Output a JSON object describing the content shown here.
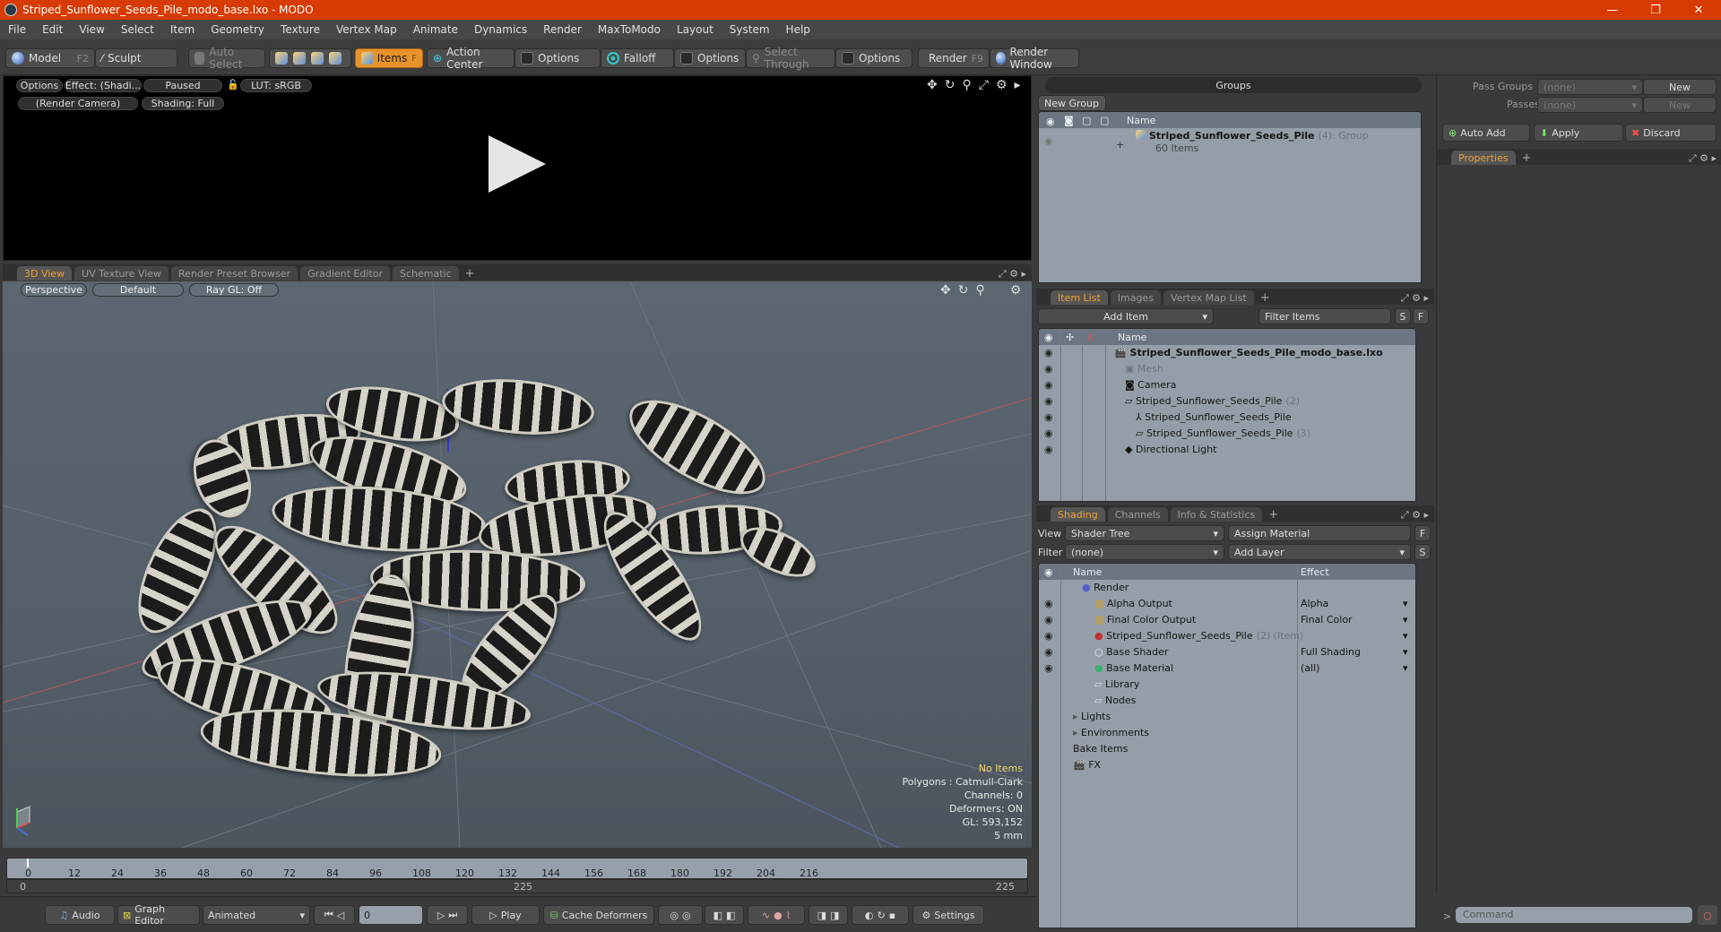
{
  "window": {
    "title": "Striped_Sunflower_Seeds_Pile_modo_base.lxo - MODO",
    "minimize": "—",
    "restore": "❐",
    "close": "✕"
  },
  "menu": [
    "File",
    "Edit",
    "View",
    "Select",
    "Item",
    "Geometry",
    "Texture",
    "Vertex Map",
    "Animate",
    "Dynamics",
    "Render",
    "MaxToModo",
    "Layout",
    "System",
    "Help"
  ],
  "toolbar": {
    "model": "Model",
    "model_key": "F2",
    "sculpt": "Sculpt",
    "auto_select": "Auto Select",
    "items": "Items",
    "items_key": "F",
    "action_center": "Action Center",
    "options1": "Options",
    "falloff": "Falloff",
    "options2": "Options",
    "select_through": "Select Through",
    "options3": "Options",
    "render": "Render",
    "render_key": "F9",
    "render_window": "Render Window"
  },
  "render_panel": {
    "options": "Options",
    "effect": "Effect: (Shadi...",
    "paused": "Paused",
    "lut": "LUT: sRGB",
    "camera": "(Render Camera)",
    "shading": "Shading: Full"
  },
  "view_tabs": [
    "3D View",
    "UV Texture View",
    "Render Preset Browser",
    "Gradient Editor",
    "Schematic"
  ],
  "viewport": {
    "perspective": "Perspective",
    "default": "Default",
    "raygl": "Ray GL: Off",
    "stats": {
      "no_items": "No Items",
      "polygons": "Polygons : Catmull-Clark",
      "channels": "Channels: 0",
      "deformers": "Deformers: ON",
      "gl": "GL: 593,152",
      "scale": "5 mm"
    }
  },
  "timeline": {
    "ticks": [
      "0",
      "12",
      "24",
      "36",
      "48",
      "60",
      "72",
      "84",
      "96",
      "108",
      "120",
      "132",
      "144",
      "156",
      "168",
      "180",
      "192",
      "204",
      "216"
    ],
    "range_start": "0",
    "range_mid": "225",
    "range_end": "225"
  },
  "bottom": {
    "audio": "Audio",
    "graph_editor": "Graph Editor",
    "animated": "Animated",
    "frame": "0",
    "play": "Play",
    "cache_deformers": "Cache Deformers",
    "settings": "Settings",
    "command_placeholder": "Command"
  },
  "groups": {
    "title": "Groups",
    "new_group": "New Group",
    "col_name": "Name",
    "item_name": "Striped_Sunflower_Seeds_Pile",
    "item_count": "(4)",
    "item_type": ": Group",
    "item_sub": "60 Items"
  },
  "passes": {
    "pass_groups_label": "Pass Groups",
    "pass_groups_value": "(none)",
    "new1": "New",
    "passes_label": "Passes",
    "passes_value": "(none)",
    "new2": "New",
    "auto_add": "Auto Add",
    "apply": "Apply",
    "discard": "Discard",
    "properties_tab": "Properties"
  },
  "item_list": {
    "tabs": [
      "Item List",
      "Images",
      "Vertex Map List"
    ],
    "add_item": "Add Item",
    "filter": "Filter Items",
    "s": "S",
    "f": "F",
    "col_name": "Name",
    "rows": [
      {
        "label": "Striped_Sunflower_Seeds_Pile_modo_base.lxo",
        "count": "",
        "indent": 0,
        "bold": true
      },
      {
        "label": "Mesh",
        "count": "",
        "indent": 1,
        "muted": true
      },
      {
        "label": "Camera",
        "count": "",
        "indent": 1
      },
      {
        "label": "Striped_Sunflower_Seeds_Pile",
        "count": "(2)",
        "indent": 1
      },
      {
        "label": "Striped_Sunflower_Seeds_Pile",
        "count": "",
        "indent": 2
      },
      {
        "label": "Striped_Sunflower_Seeds_Pile",
        "count": "(3)",
        "indent": 2
      },
      {
        "label": "Directional Light",
        "count": "",
        "indent": 1
      }
    ]
  },
  "shading": {
    "tabs": [
      "Shading",
      "Channels",
      "Info & Statistics"
    ],
    "view_label": "View",
    "view_value": "Shader Tree",
    "assign_material": "Assign Material",
    "f": "F",
    "filter_label": "Filter",
    "filter_value": "(none)",
    "add_layer": "Add Layer",
    "s": "S",
    "col_name": "Name",
    "col_effect": "Effect",
    "rows": [
      {
        "label": "Render",
        "effect": "",
        "indent": 0,
        "suffix": ""
      },
      {
        "label": "Alpha Output",
        "effect": "Alpha",
        "indent": 1,
        "suffix": ""
      },
      {
        "label": "Final Color Output",
        "effect": "Final Color",
        "indent": 1,
        "suffix": ""
      },
      {
        "label": "Striped_Sunflower_Seeds_Pile",
        "effect": "",
        "indent": 1,
        "suffix": "(2) (Item)"
      },
      {
        "label": "Base Shader",
        "effect": "Full Shading",
        "indent": 1,
        "suffix": ""
      },
      {
        "label": "Base Material",
        "effect": "(all)",
        "indent": 1,
        "suffix": ""
      },
      {
        "label": "Library",
        "effect": "",
        "indent": 1,
        "suffix": ""
      },
      {
        "label": "Nodes",
        "effect": "",
        "indent": 1,
        "suffix": ""
      },
      {
        "label": "Lights",
        "effect": "",
        "indent": 0,
        "suffix": ""
      },
      {
        "label": "Environments",
        "effect": "",
        "indent": 0,
        "suffix": ""
      },
      {
        "label": "Bake Items",
        "effect": "",
        "indent": 0,
        "suffix": ""
      },
      {
        "label": "FX",
        "effect": "",
        "indent": 0,
        "suffix": ""
      }
    ]
  }
}
